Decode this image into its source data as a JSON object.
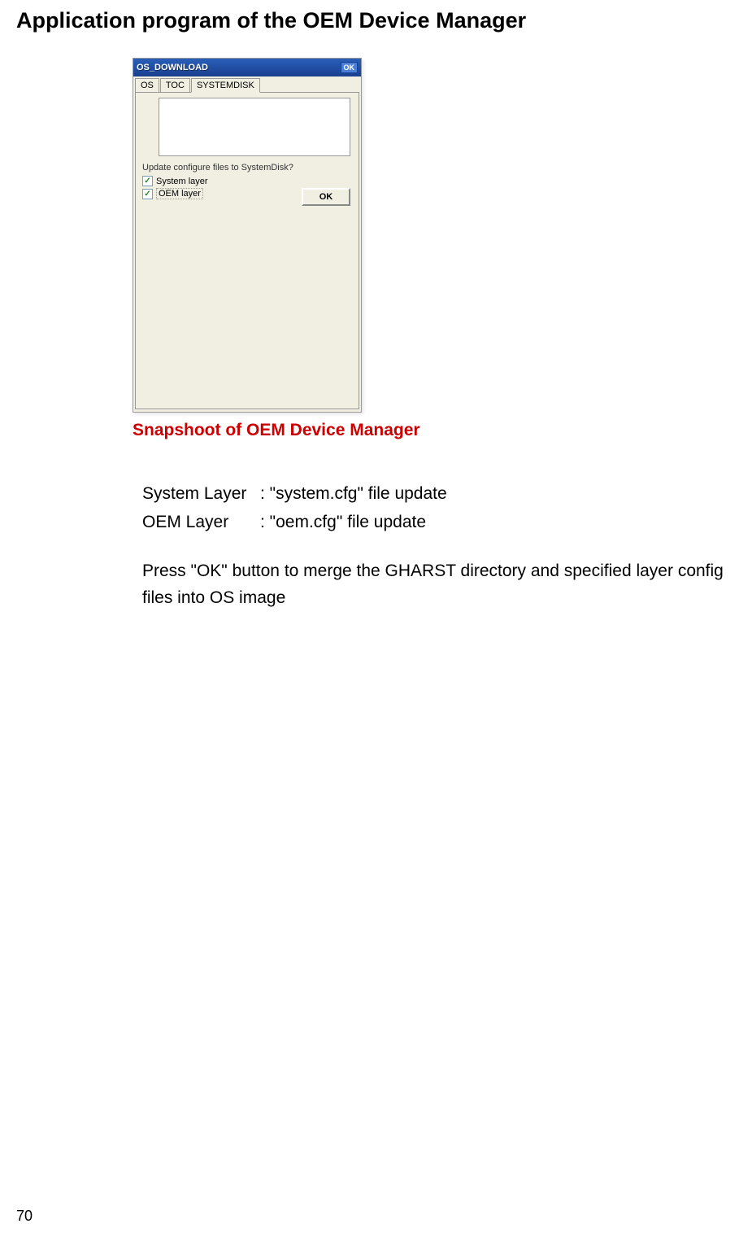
{
  "page_title": "Application program of the OEM Device Manager",
  "window": {
    "title": "OS_DOWNLOAD",
    "title_ok": "OK",
    "tabs": [
      {
        "label": "OS"
      },
      {
        "label": "TOC"
      },
      {
        "label": "SYSTEMDISK"
      }
    ],
    "question": "Update configure files to SystemDisk?",
    "checkboxes": [
      {
        "label": "System layer",
        "checked": true
      },
      {
        "label": "OEM layer",
        "checked": true
      }
    ],
    "ok_button": "OK"
  },
  "caption": "Snapshoot of OEM Device Manager",
  "body": {
    "rows": [
      {
        "label": "System Layer",
        "value": ": \"system.cfg\" file update"
      },
      {
        "label": "OEM Layer",
        "value": ": \"oem.cfg\" file update"
      }
    ],
    "paragraph": "Press \"OK\" button to merge the GHARST directory and specified layer config files into OS image"
  },
  "page_number": "70"
}
